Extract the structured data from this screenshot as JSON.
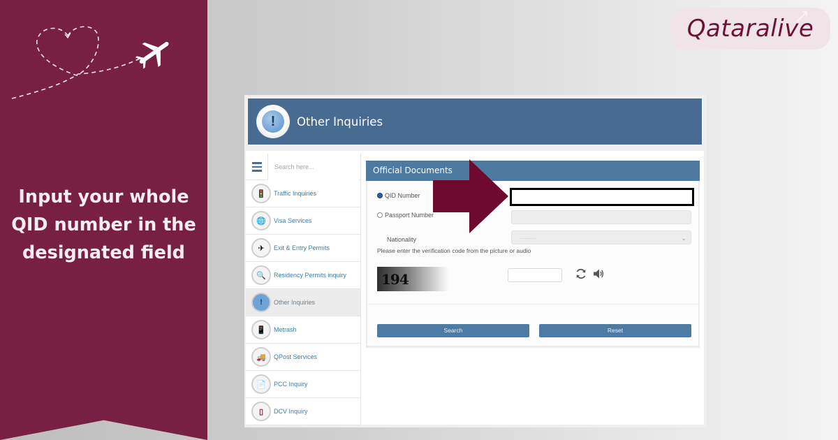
{
  "brand": {
    "logo_text": "Qataralive",
    "primary_color": "#772043",
    "accent_blue": "#4e7aa0"
  },
  "instruction": {
    "lines": [
      "Input your whole",
      "QID number in the",
      "designated field"
    ]
  },
  "decor": {
    "heart_icon": "dashed-heart",
    "plane_icon": "airplane"
  },
  "portal": {
    "header_title": "Other Inquiries",
    "header_icon": "exclamation-bubble",
    "search": {
      "placeholder": "Search here..."
    },
    "sidebar": {
      "items": [
        {
          "label": "Traffic Inquiries",
          "icon": "traffic-light",
          "active": false
        },
        {
          "label": "Visa Services",
          "icon": "globe",
          "active": false
        },
        {
          "label": "Exit & Entry Permits",
          "icon": "plane",
          "active": false
        },
        {
          "label": "Residency Permits inquiry",
          "icon": "magnifier",
          "active": false
        },
        {
          "label": "Other Inquiries",
          "icon": "exclamation",
          "active": true
        },
        {
          "label": "Metrash",
          "icon": "phone",
          "active": false
        },
        {
          "label": "QPost Services",
          "icon": "truck",
          "active": false
        },
        {
          "label": "PCC Inquiry",
          "icon": "certificate",
          "active": false
        },
        {
          "label": "DCV Inquiry",
          "icon": "document",
          "active": false
        }
      ]
    },
    "form": {
      "title": "Official Documents",
      "qid_label": "QID Number",
      "qid_selected": true,
      "qid_value": "",
      "passport_label": "Passport Number",
      "passport_selected": false,
      "passport_value": "",
      "nationality_label": "Nationality",
      "nationality_value": "...........",
      "verify_text": "Please enter the verification code from the picture or audio",
      "captcha_code": "194",
      "captcha_input": "",
      "search_button": "Search",
      "reset_button": "Reset"
    }
  }
}
